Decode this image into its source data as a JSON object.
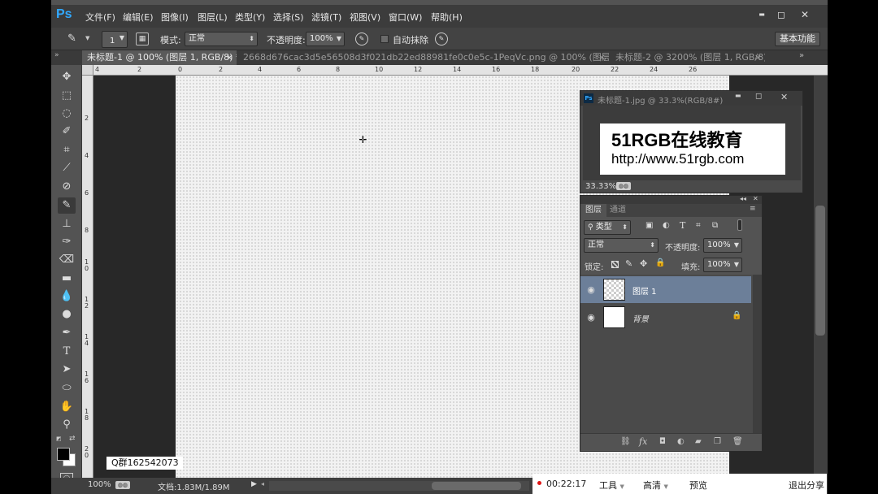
{
  "app": {
    "logo": "Ps"
  },
  "menu": [
    "文件(F)",
    "编辑(E)",
    "图像(I)",
    "图层(L)",
    "类型(Y)",
    "选择(S)",
    "滤镜(T)",
    "视图(V)",
    "窗口(W)",
    "帮助(H)"
  ],
  "window_controls": {
    "minimize": "▬",
    "restore": "◻",
    "close": "✕"
  },
  "options": {
    "brush_size": "1",
    "mode_label": "模式:",
    "mode_value": "正常",
    "opacity_label": "不透明度:",
    "opacity_value": "100%",
    "auto_erase_label": "自动抹除",
    "workspace": "基本功能"
  },
  "tabs": [
    {
      "label": "未标题-1 @ 100% (图层 1, RGB/8) *",
      "active": true
    },
    {
      "label": "2668d676cac3d5e56508d3f021db22ed88981fe0c0e5c-1PeqVc.png @ 100% (图层 0, RGB/8#)",
      "active": false
    },
    {
      "label": "未标题-2 @ 3200% (图层 1, RGB/8) *",
      "active": false
    }
  ],
  "tab_close": "×",
  "ruler_top": [
    "4",
    "2",
    "0",
    "2",
    "4",
    "6",
    "8",
    "10",
    "12",
    "14",
    "16",
    "18",
    "20",
    "22",
    "24",
    "26"
  ],
  "ruler_left": [
    "2",
    "4",
    "6",
    "8",
    "1 0",
    "1 2",
    "1 4",
    "1 6",
    "1 8",
    "2 0",
    "2 2"
  ],
  "float_window": {
    "title": "未标题-1.jpg @ 33.3%(RGB/8#)",
    "line1": "51RGB在线教育",
    "line2": "http://www.51rgb.com",
    "zoom": "33.33%"
  },
  "layers_panel": {
    "tab_layers": "图层",
    "tab_channels": "通道",
    "filter_kind": "类型",
    "blend_mode": "正常",
    "opacity_label": "不透明度:",
    "opacity_value": "100%",
    "lock_label": "锁定:",
    "fill_label": "填充:",
    "fill_value": "100%",
    "layers": [
      {
        "name": "图层 1",
        "selected": true,
        "locked": false
      },
      {
        "name": "背景",
        "selected": false,
        "locked": true
      }
    ]
  },
  "status": {
    "zoom": "100%",
    "doc": "文档:1.83M/1.89M"
  },
  "overlay": {
    "time": "00:22:17",
    "tools": "工具",
    "quality": "高清",
    "preview": "预览",
    "exit": "退出分享"
  },
  "watermark": "Q群162542073",
  "colors": {
    "accent": "#31a8ff",
    "selected_layer": "#6c7f99",
    "frame_red": "#e01515"
  }
}
